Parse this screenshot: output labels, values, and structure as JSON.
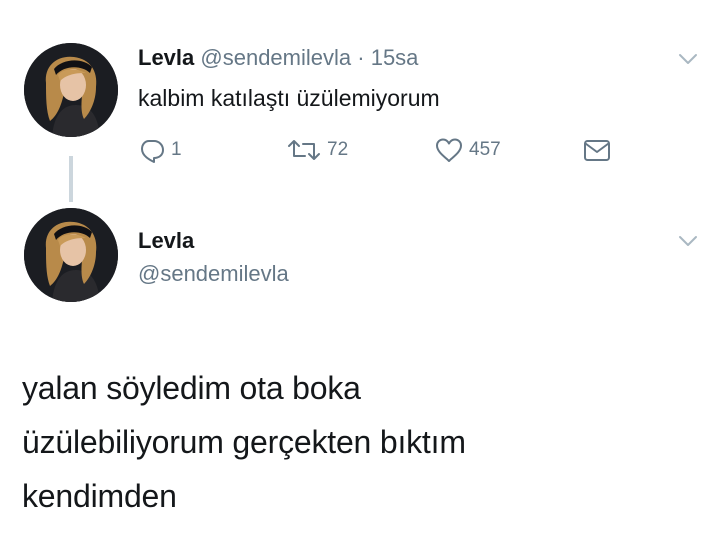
{
  "tweet1": {
    "name": "Levla",
    "handle": "@sendemilevla",
    "separator": "·",
    "time": "15sa",
    "text": "kalbim katılaştı üzülemiyorum",
    "replies": "1",
    "retweets": "72",
    "likes": "457",
    "icons": [
      "reply-icon",
      "retweet-icon",
      "like-icon",
      "direct-message-icon",
      "chevron-down-icon"
    ]
  },
  "tweet2": {
    "name": "Levla",
    "handle": "@sendemilevla",
    "text_lines": [
      "yalan söyledim ota boka",
      "üzülebiliyorum gerçekten bıktım",
      "kendimden"
    ]
  },
  "colors": {
    "text": "#14171a",
    "muted": "#657786",
    "thread_line": "#ccd6dd",
    "background": "#ffffff"
  }
}
